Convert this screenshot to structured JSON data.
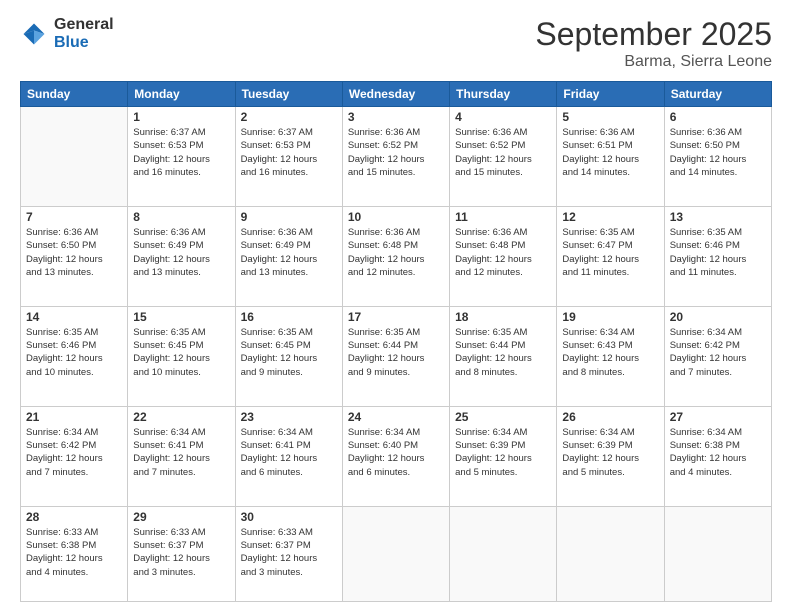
{
  "logo": {
    "general": "General",
    "blue": "Blue"
  },
  "header": {
    "month": "September 2025",
    "location": "Barma, Sierra Leone"
  },
  "weekdays": [
    "Sunday",
    "Monday",
    "Tuesday",
    "Wednesday",
    "Thursday",
    "Friday",
    "Saturday"
  ],
  "weeks": [
    [
      {
        "day": "",
        "info": ""
      },
      {
        "day": "1",
        "info": "Sunrise: 6:37 AM\nSunset: 6:53 PM\nDaylight: 12 hours\nand 16 minutes."
      },
      {
        "day": "2",
        "info": "Sunrise: 6:37 AM\nSunset: 6:53 PM\nDaylight: 12 hours\nand 16 minutes."
      },
      {
        "day": "3",
        "info": "Sunrise: 6:36 AM\nSunset: 6:52 PM\nDaylight: 12 hours\nand 15 minutes."
      },
      {
        "day": "4",
        "info": "Sunrise: 6:36 AM\nSunset: 6:52 PM\nDaylight: 12 hours\nand 15 minutes."
      },
      {
        "day": "5",
        "info": "Sunrise: 6:36 AM\nSunset: 6:51 PM\nDaylight: 12 hours\nand 14 minutes."
      },
      {
        "day": "6",
        "info": "Sunrise: 6:36 AM\nSunset: 6:50 PM\nDaylight: 12 hours\nand 14 minutes."
      }
    ],
    [
      {
        "day": "7",
        "info": "Sunrise: 6:36 AM\nSunset: 6:50 PM\nDaylight: 12 hours\nand 13 minutes."
      },
      {
        "day": "8",
        "info": "Sunrise: 6:36 AM\nSunset: 6:49 PM\nDaylight: 12 hours\nand 13 minutes."
      },
      {
        "day": "9",
        "info": "Sunrise: 6:36 AM\nSunset: 6:49 PM\nDaylight: 12 hours\nand 13 minutes."
      },
      {
        "day": "10",
        "info": "Sunrise: 6:36 AM\nSunset: 6:48 PM\nDaylight: 12 hours\nand 12 minutes."
      },
      {
        "day": "11",
        "info": "Sunrise: 6:36 AM\nSunset: 6:48 PM\nDaylight: 12 hours\nand 12 minutes."
      },
      {
        "day": "12",
        "info": "Sunrise: 6:35 AM\nSunset: 6:47 PM\nDaylight: 12 hours\nand 11 minutes."
      },
      {
        "day": "13",
        "info": "Sunrise: 6:35 AM\nSunset: 6:46 PM\nDaylight: 12 hours\nand 11 minutes."
      }
    ],
    [
      {
        "day": "14",
        "info": "Sunrise: 6:35 AM\nSunset: 6:46 PM\nDaylight: 12 hours\nand 10 minutes."
      },
      {
        "day": "15",
        "info": "Sunrise: 6:35 AM\nSunset: 6:45 PM\nDaylight: 12 hours\nand 10 minutes."
      },
      {
        "day": "16",
        "info": "Sunrise: 6:35 AM\nSunset: 6:45 PM\nDaylight: 12 hours\nand 9 minutes."
      },
      {
        "day": "17",
        "info": "Sunrise: 6:35 AM\nSunset: 6:44 PM\nDaylight: 12 hours\nand 9 minutes."
      },
      {
        "day": "18",
        "info": "Sunrise: 6:35 AM\nSunset: 6:44 PM\nDaylight: 12 hours\nand 8 minutes."
      },
      {
        "day": "19",
        "info": "Sunrise: 6:34 AM\nSunset: 6:43 PM\nDaylight: 12 hours\nand 8 minutes."
      },
      {
        "day": "20",
        "info": "Sunrise: 6:34 AM\nSunset: 6:42 PM\nDaylight: 12 hours\nand 7 minutes."
      }
    ],
    [
      {
        "day": "21",
        "info": "Sunrise: 6:34 AM\nSunset: 6:42 PM\nDaylight: 12 hours\nand 7 minutes."
      },
      {
        "day": "22",
        "info": "Sunrise: 6:34 AM\nSunset: 6:41 PM\nDaylight: 12 hours\nand 7 minutes."
      },
      {
        "day": "23",
        "info": "Sunrise: 6:34 AM\nSunset: 6:41 PM\nDaylight: 12 hours\nand 6 minutes."
      },
      {
        "day": "24",
        "info": "Sunrise: 6:34 AM\nSunset: 6:40 PM\nDaylight: 12 hours\nand 6 minutes."
      },
      {
        "day": "25",
        "info": "Sunrise: 6:34 AM\nSunset: 6:39 PM\nDaylight: 12 hours\nand 5 minutes."
      },
      {
        "day": "26",
        "info": "Sunrise: 6:34 AM\nSunset: 6:39 PM\nDaylight: 12 hours\nand 5 minutes."
      },
      {
        "day": "27",
        "info": "Sunrise: 6:34 AM\nSunset: 6:38 PM\nDaylight: 12 hours\nand 4 minutes."
      }
    ],
    [
      {
        "day": "28",
        "info": "Sunrise: 6:33 AM\nSunset: 6:38 PM\nDaylight: 12 hours\nand 4 minutes."
      },
      {
        "day": "29",
        "info": "Sunrise: 6:33 AM\nSunset: 6:37 PM\nDaylight: 12 hours\nand 3 minutes."
      },
      {
        "day": "30",
        "info": "Sunrise: 6:33 AM\nSunset: 6:37 PM\nDaylight: 12 hours\nand 3 minutes."
      },
      {
        "day": "",
        "info": ""
      },
      {
        "day": "",
        "info": ""
      },
      {
        "day": "",
        "info": ""
      },
      {
        "day": "",
        "info": ""
      }
    ]
  ]
}
